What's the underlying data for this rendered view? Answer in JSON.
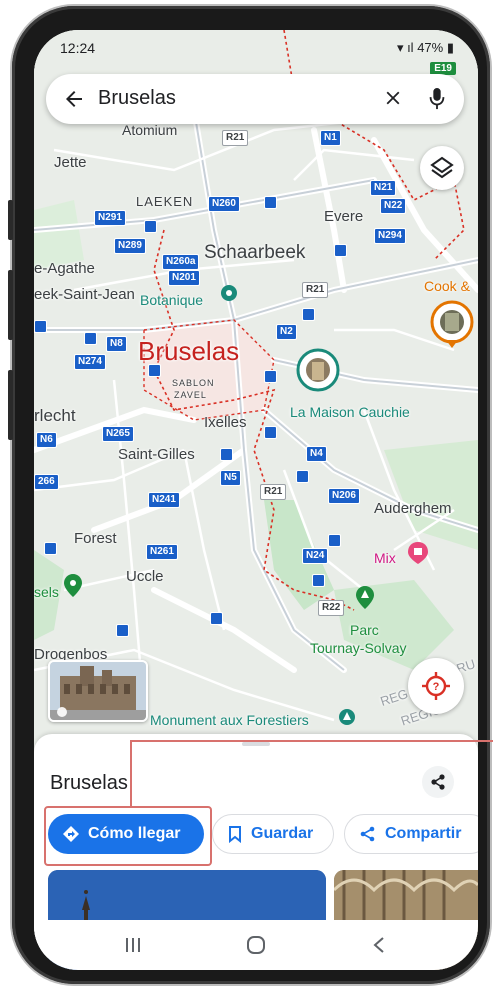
{
  "status_bar": {
    "time": "12:24",
    "battery": "47%"
  },
  "search": {
    "query": "Bruselas"
  },
  "map": {
    "labels": {
      "atomium": "Atomium",
      "jette": "Jette",
      "laeken": "LAEKEN",
      "evere": "Evere",
      "schaarbeek": "Schaarbeek",
      "agathe": "e-Agathe",
      "saint_jean": "eek-Saint-Jean",
      "botanique": "Botanique",
      "cook": "Cook &",
      "bruselas": "Bruselas",
      "sablon": "SABLON",
      "zavel": "ZAVEL",
      "ixelles": "Ixelles",
      "maison": "La Maison Cauchie",
      "anderlecht": "rlecht",
      "saint_gilles": "Saint-Gilles",
      "auderghem": "Auderghem",
      "forest": "Forest",
      "uccle": "Uccle",
      "mix": "Mix",
      "sels": "sels",
      "parc": "Parc",
      "tournay": "Tournay-Solvay",
      "drogenbos": "Drogenbos",
      "monument": "Monument aux Forestiers",
      "reg1": "REG",
      "reg2": "REGIÓN",
      "bru": "BRU"
    },
    "shields": {
      "r21a": "R21",
      "n1": "N1",
      "n21": "N21",
      "n22": "N22",
      "n294": "N294",
      "n291": "N291",
      "n260": "N260",
      "n289": "N289",
      "n260a": "N260a",
      "n201": "N201",
      "r21b": "R21",
      "n2": "N2",
      "n8": "N8",
      "n274": "N274",
      "n265": "N265",
      "n6": "N6",
      "n4": "N4",
      "n5": "N5",
      "r21c": "R21",
      "n206": "N206",
      "n266": "266",
      "n241": "N241",
      "n261": "N261",
      "n24": "N24",
      "r22": "R22",
      "e19": "E19"
    }
  },
  "sheet": {
    "title": "Bruselas",
    "directions_label": "Cómo llegar",
    "save_label": "Guardar",
    "share_label": "Compartir"
  },
  "colors": {
    "primary": "#1a73e8",
    "highlight": "#d8716d",
    "city_label": "#c5221f"
  }
}
